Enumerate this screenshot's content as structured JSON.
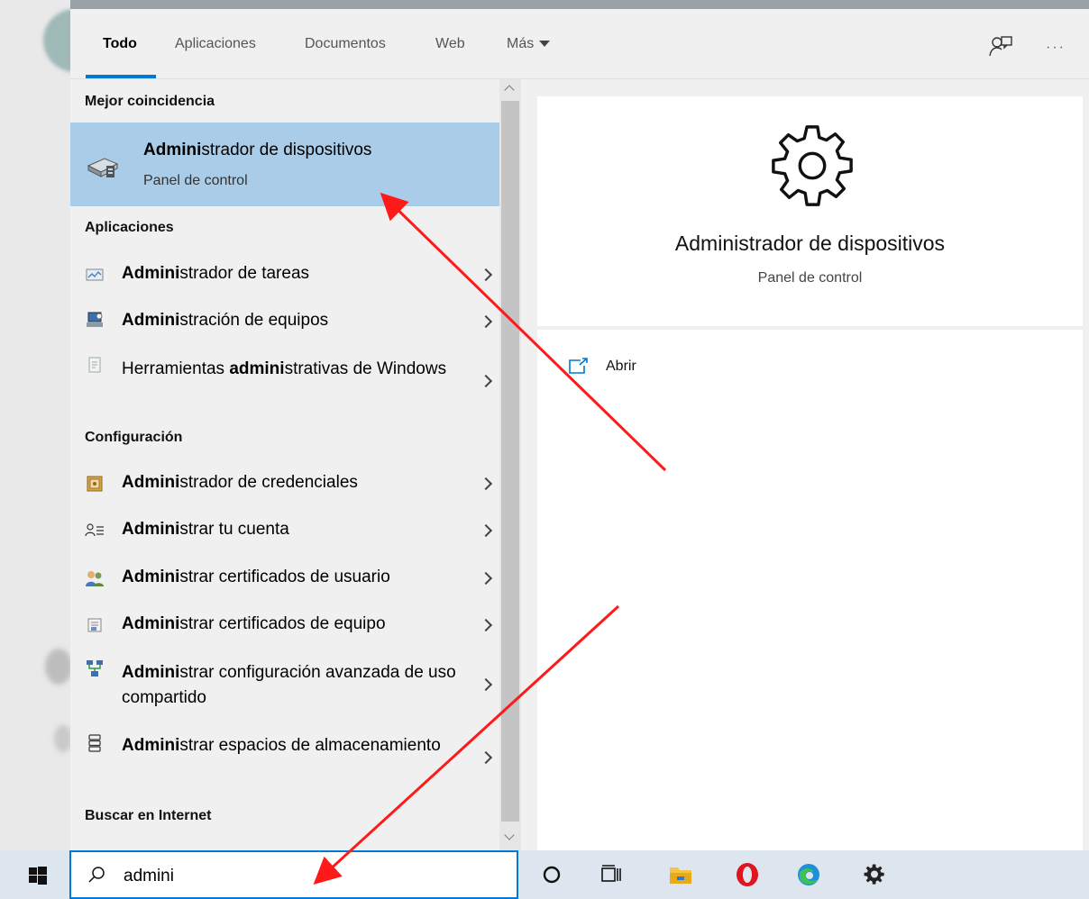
{
  "tabs": {
    "items": [
      "Todo",
      "Aplicaciones",
      "Documentos",
      "Web",
      "Más"
    ],
    "active": "Todo"
  },
  "sections": {
    "best_match": "Mejor coincidencia",
    "apps": "Aplicaciones",
    "settings": "Configuración",
    "internet": "Buscar en Internet"
  },
  "best_match": {
    "title_bold": "Admini",
    "title_rest": "strador de dispositivos",
    "subtitle": "Panel de control"
  },
  "apps": [
    {
      "bold": "Admini",
      "rest": "strador de tareas",
      "icon": "task-manager-icon"
    },
    {
      "bold": "Admini",
      "rest": "stración de equipos",
      "icon": "computer-management-icon"
    },
    {
      "pre": "Herramientas ",
      "bold": "admini",
      "rest": "strativas de Windows",
      "icon": "admin-tools-icon"
    }
  ],
  "settings": [
    {
      "bold": "Admini",
      "rest": "strador de credenciales",
      "icon": "credential-manager-icon"
    },
    {
      "bold": "Admini",
      "rest": "strar tu cuenta",
      "icon": "account-icon"
    },
    {
      "bold": "Admini",
      "rest": "strar certificados de usuario",
      "icon": "user-certificates-icon"
    },
    {
      "bold": "Admini",
      "rest": "strar certificados de equipo",
      "icon": "computer-certificates-icon"
    },
    {
      "bold": "Admini",
      "rest": "strar configuración avanzada de uso compartido",
      "icon": "sharing-settings-icon"
    },
    {
      "bold": "Admini",
      "rest": "strar espacios de almacenamiento",
      "icon": "storage-spaces-icon"
    }
  ],
  "preview": {
    "title": "Administrador de dispositivos",
    "subtitle": "Panel de control",
    "action_open": "Abrir"
  },
  "search": {
    "value": "admini"
  },
  "taskbar": {
    "icons": [
      "start-icon",
      "cortana-icon",
      "task-view-icon",
      "file-explorer-icon",
      "opera-icon",
      "edge-icon",
      "settings-icon"
    ]
  },
  "colors": {
    "accent": "#0078d4",
    "selection": "#a9cde8",
    "annotation": "#ff1a1a"
  }
}
